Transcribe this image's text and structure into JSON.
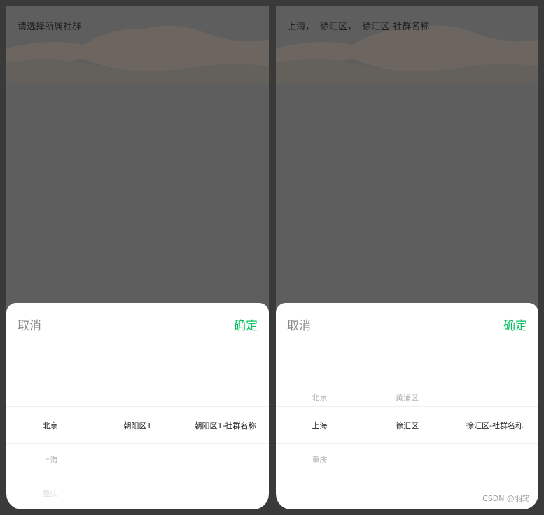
{
  "left": {
    "header": "请选择所属社群",
    "toolbar": {
      "cancel": "取消",
      "confirm": "确定"
    },
    "columns": [
      {
        "above2": "",
        "above1": "",
        "selected": "北京",
        "below1": "上海",
        "below2": "重庆"
      },
      {
        "above2": "",
        "above1": "",
        "selected": "朝阳区1",
        "below1": "",
        "below2": ""
      },
      {
        "above2": "",
        "above1": "",
        "selected": "朝阳区1-社群名称",
        "below1": "",
        "below2": ""
      }
    ]
  },
  "right": {
    "header": "上海，  徐汇区，  徐汇区-社群名称",
    "toolbar": {
      "cancel": "取消",
      "confirm": "确定"
    },
    "columns": [
      {
        "above2": "",
        "above1": "北京",
        "selected": "上海",
        "below1": "重庆",
        "below2": ""
      },
      {
        "above2": "",
        "above1": "黄浦区",
        "selected": "徐汇区",
        "below1": "",
        "below2": ""
      },
      {
        "above2": "",
        "above1": "",
        "selected": "徐汇区-社群名称",
        "below1": "",
        "below2": ""
      }
    ]
  },
  "watermark": "CSDN @羽筠",
  "colors": {
    "accent": "#07c160",
    "cancel": "#888888",
    "overlay": "#5e5e5e"
  }
}
